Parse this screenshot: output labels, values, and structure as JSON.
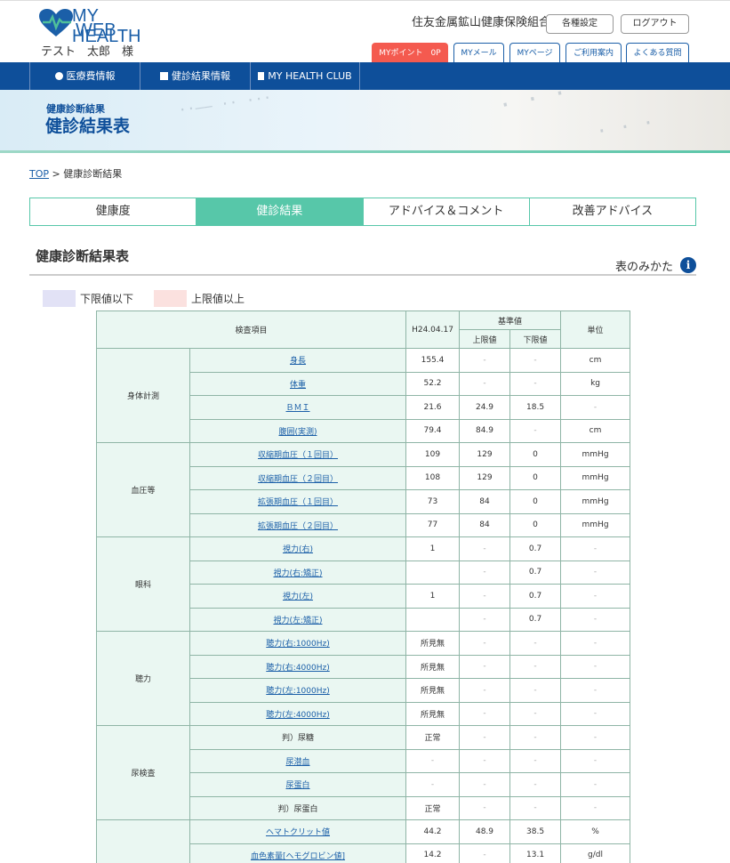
{
  "header": {
    "logo_line1": "MY HEALTH",
    "logo_line2": "WEB",
    "user_name": "テスト　太郎　様",
    "organization": "住友金属鉱山健康保険組合",
    "buttons": {
      "settings": "各種設定",
      "logout": "ログアウト"
    },
    "tabs": [
      {
        "label": "MYポイント　0P"
      },
      {
        "label": "MYメール"
      },
      {
        "label": "MYページ"
      },
      {
        "label": "ご利用案内"
      },
      {
        "label": "よくある質問"
      }
    ]
  },
  "nav": {
    "items": [
      {
        "label": "医療費情報"
      },
      {
        "label": "健診結果情報"
      },
      {
        "label": "MY HEALTH CLUB"
      }
    ]
  },
  "banner": {
    "subtitle": "健康診断結果",
    "title": "健診結果表"
  },
  "breadcrumb": {
    "top": "TOP",
    "separator": ">",
    "current": "健康診断結果"
  },
  "tabs": [
    {
      "label": "健康度"
    },
    {
      "label": "健診結果"
    },
    {
      "label": "アドバイス＆コメント"
    },
    {
      "label": "改善アドバイス"
    }
  ],
  "section": {
    "title": "健康診断結果表",
    "howto": "表のみかた"
  },
  "legend": {
    "lower": {
      "label": "下限値以下",
      "color": "#e2e2f6"
    },
    "upper": {
      "label": "上限値以上",
      "color": "#fbe1df"
    }
  },
  "table": {
    "headers": {
      "item": "検査項目",
      "date": "H24.04.17",
      "standard": "基準値",
      "upper": "上限値",
      "lower": "下限値",
      "unit": "単位"
    },
    "groups": [
      {
        "category": "身体計測",
        "rows": [
          {
            "name": "身長",
            "link": true,
            "value": "155.4",
            "upper": "-",
            "lower": "-",
            "unit": "cm"
          },
          {
            "name": "体重",
            "link": true,
            "value": "52.2",
            "upper": "-",
            "lower": "-",
            "unit": "kg"
          },
          {
            "name": "ＢＭＩ",
            "link": true,
            "value": "21.6",
            "upper": "24.9",
            "lower": "18.5",
            "unit": "-"
          },
          {
            "name": "腹囲(実測)",
            "link": true,
            "value": "79.4",
            "upper": "84.9",
            "lower": "-",
            "unit": "cm"
          }
        ]
      },
      {
        "category": "血圧等",
        "rows": [
          {
            "name": "収縮期血圧（１回目）",
            "link": true,
            "value": "109",
            "upper": "129",
            "lower": "0",
            "unit": "mmHg"
          },
          {
            "name": "収縮期血圧（２回目）",
            "link": true,
            "value": "108",
            "upper": "129",
            "lower": "0",
            "unit": "mmHg"
          },
          {
            "name": "拡張期血圧（１回目）",
            "link": true,
            "value": "73",
            "upper": "84",
            "lower": "0",
            "unit": "mmHg"
          },
          {
            "name": "拡張期血圧（２回目）",
            "link": true,
            "value": "77",
            "upper": "84",
            "lower": "0",
            "unit": "mmHg"
          }
        ]
      },
      {
        "category": "眼科",
        "rows": [
          {
            "name": "視力(右)",
            "link": true,
            "value": "1",
            "upper": "-",
            "lower": "0.7",
            "unit": "-"
          },
          {
            "name": "視力(右:矯正)",
            "link": true,
            "value": "",
            "upper": "-",
            "lower": "0.7",
            "unit": "-"
          },
          {
            "name": "視力(左)",
            "link": true,
            "value": "1",
            "upper": "-",
            "lower": "0.7",
            "unit": "-"
          },
          {
            "name": "視力(左:矯正)",
            "link": true,
            "value": "",
            "upper": "-",
            "lower": "0.7",
            "unit": "-"
          }
        ]
      },
      {
        "category": "聴力",
        "rows": [
          {
            "name": "聴力(右:1000Hz)",
            "link": true,
            "value": "所見無",
            "upper": "-",
            "lower": "-",
            "unit": "-"
          },
          {
            "name": "聴力(右:4000Hz)",
            "link": true,
            "value": "所見無",
            "upper": "-",
            "lower": "-",
            "unit": "-"
          },
          {
            "name": "聴力(左:1000Hz)",
            "link": true,
            "value": "所見無",
            "upper": "-",
            "lower": "-",
            "unit": "-"
          },
          {
            "name": "聴力(左:4000Hz)",
            "link": true,
            "value": "所見無",
            "upper": "-",
            "lower": "-",
            "unit": "-"
          }
        ]
      },
      {
        "category": "尿検査",
        "rows": [
          {
            "name": "判）尿糖",
            "link": false,
            "value": "正常",
            "upper": "-",
            "lower": "-",
            "unit": "-"
          },
          {
            "name": "尿潜血",
            "link": true,
            "value": "-",
            "upper": "-",
            "lower": "-",
            "unit": "-"
          },
          {
            "name": "尿蛋白",
            "link": true,
            "value": "-",
            "upper": "-",
            "lower": "-",
            "unit": "-"
          },
          {
            "name": "判）尿蛋白",
            "link": false,
            "value": "正常",
            "upper": "-",
            "lower": "-",
            "unit": "-"
          }
        ]
      },
      {
        "category": "",
        "rows": [
          {
            "name": "ヘマトクリット値",
            "link": true,
            "value": "44.2",
            "upper": "48.9",
            "lower": "38.5",
            "unit": "%"
          },
          {
            "name": "血色素量[ヘモグロビン値]",
            "link": true,
            "value": "14.2",
            "upper": "-",
            "lower": "13.1",
            "unit": "g/dl"
          }
        ]
      }
    ]
  }
}
